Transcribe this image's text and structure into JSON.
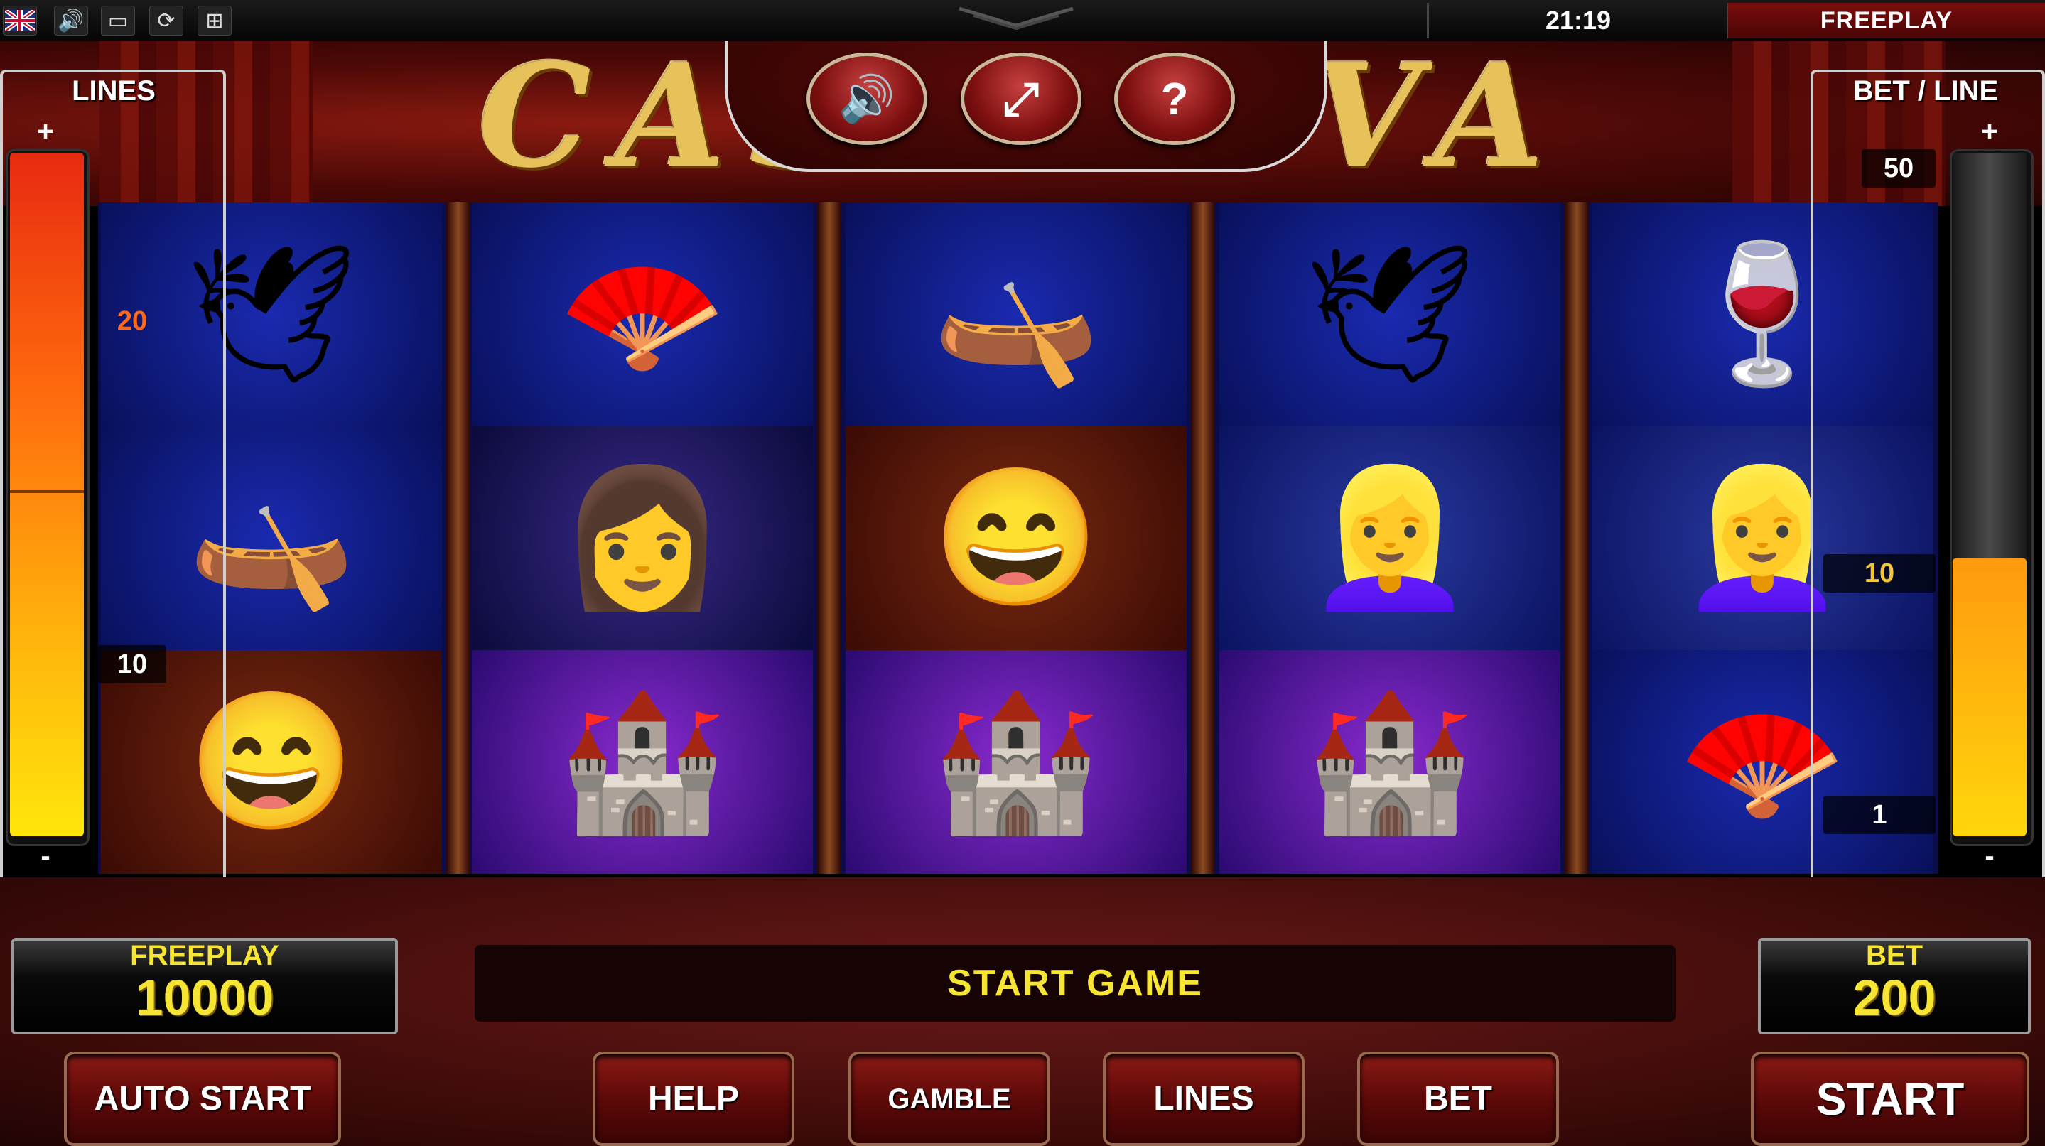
{
  "topbar": {
    "icons": [
      "uk-flag-icon",
      "speaker-icon",
      "window-icon",
      "refresh-icon",
      "fullscreen-icon"
    ],
    "clock": "21:19",
    "mode": "FREEPLAY"
  },
  "header": {
    "logo": "CASANOVA",
    "controls": {
      "sound_icon": "🔊",
      "fullscreen_icon": "⤢",
      "help_icon": "?"
    }
  },
  "lines_panel": {
    "title": "LINES",
    "plus": "+",
    "minus": "-",
    "marks": [
      "20",
      "10"
    ]
  },
  "bet_panel": {
    "title": "BET / LINE",
    "plus": "+",
    "minus": "-",
    "marks": [
      "50",
      "10",
      "1"
    ]
  },
  "reels": [
    [
      "🕊",
      "🛶",
      "😄"
    ],
    [
      "🪭",
      "👩",
      "🏰"
    ],
    [
      "🛶",
      "😄",
      "🏰"
    ],
    [
      "🕊",
      "👱‍♀️",
      "🏰"
    ],
    [
      "🍷",
      "👱‍♀️",
      "🪭"
    ]
  ],
  "reel_symbols": [
    [
      "doves-box-symbol",
      "gondola-symbol",
      "casanova-symbol"
    ],
    [
      "fan-symbol",
      "lady-dark-symbol",
      "venice-symbol"
    ],
    [
      "gondola-symbol",
      "casanova-symbol",
      "venice-symbol"
    ],
    [
      "doves-box-symbol",
      "lady-blonde-symbol",
      "venice-symbol"
    ],
    [
      "wine-glass-symbol",
      "lady-blonde-symbol",
      "fan-symbol"
    ]
  ],
  "balance": {
    "label": "FREEPLAY",
    "value": "10000"
  },
  "message": "START GAME",
  "bet": {
    "label": "BET",
    "value": "200"
  },
  "buttons": {
    "auto_start": "AUTO START",
    "help": "HELP",
    "gamble": "GAMBLE",
    "lines": "LINES",
    "bet": "BET",
    "start": "START"
  },
  "colors": {
    "accent_yellow": "#f6e533",
    "panel_red": "#7a0d0d"
  }
}
